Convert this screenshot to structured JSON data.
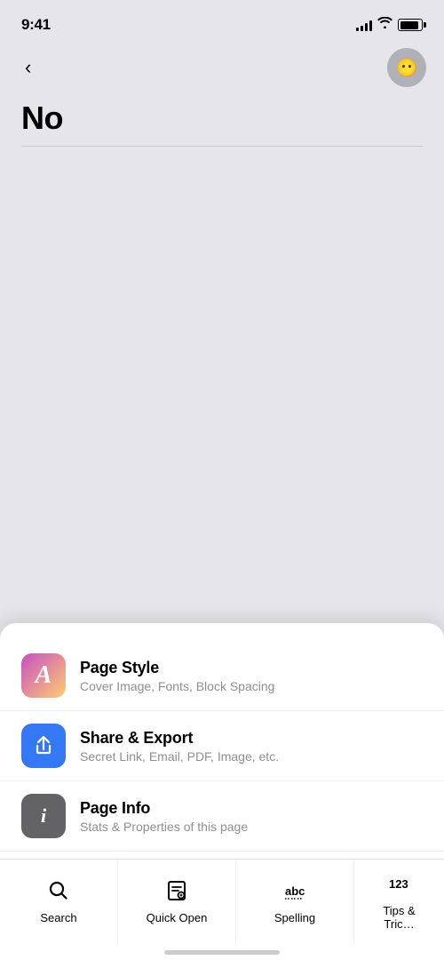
{
  "statusBar": {
    "time": "9:41"
  },
  "header": {
    "back_label": "<",
    "avatar_emoji": "😶"
  },
  "page": {
    "title": "No"
  },
  "bottomSheet": {
    "menuItems": [
      {
        "id": "page-style",
        "icon": "A",
        "iconStyle": "page-style",
        "title": "Page Style",
        "subtitle": "Cover Image, Fonts, Block Spacing"
      },
      {
        "id": "share-export",
        "icon": "share",
        "iconStyle": "share",
        "title": "Share & Export",
        "subtitle": "Secret Link, Email, PDF, Image, etc."
      },
      {
        "id": "page-info",
        "icon": "i",
        "iconStyle": "info",
        "title": "Page Info",
        "subtitle": "Stats & Properties of this page"
      }
    ],
    "toolbarItems": [
      {
        "id": "search",
        "label": "Search",
        "icon": "search"
      },
      {
        "id": "quick-open",
        "label": "Quick Open",
        "icon": "quick-open"
      },
      {
        "id": "spelling",
        "label": "Spelling",
        "icon": "spelling"
      },
      {
        "id": "tips-tricks",
        "label": "Tips & Tricks",
        "icon": "tips",
        "partial": true
      }
    ]
  }
}
